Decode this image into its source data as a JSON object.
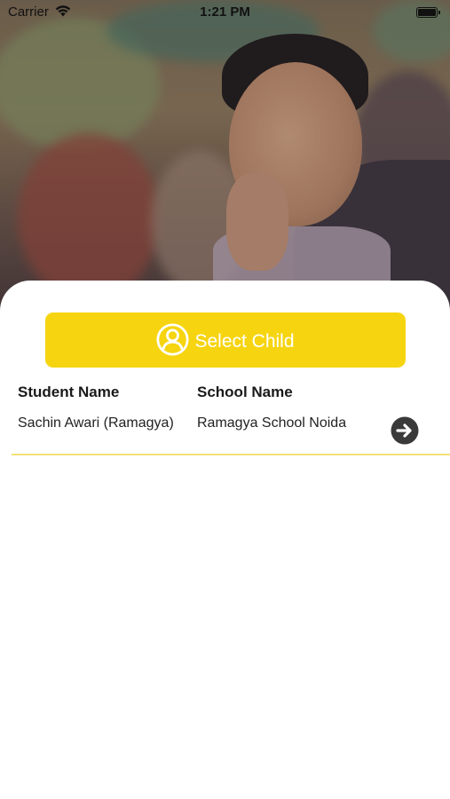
{
  "status_bar": {
    "carrier": "Carrier",
    "time": "1:21 PM"
  },
  "hero": {
    "image": "smiling-child-classroom-photo"
  },
  "select_child": {
    "label": "Select Child",
    "icon": "user-circle-icon",
    "background_color": "#f6d410"
  },
  "table": {
    "headers": [
      "Student Name",
      "School Name"
    ],
    "rows": [
      {
        "student_name": "Sachin Awari (Ramagya)",
        "school_name": "Ramagya School Noida",
        "action_icon": "arrow-right-circle-icon"
      }
    ]
  },
  "colors": {
    "accent": "#f6d410",
    "divider": "#f6e07a",
    "arrow_icon": "#3a3a3a"
  }
}
